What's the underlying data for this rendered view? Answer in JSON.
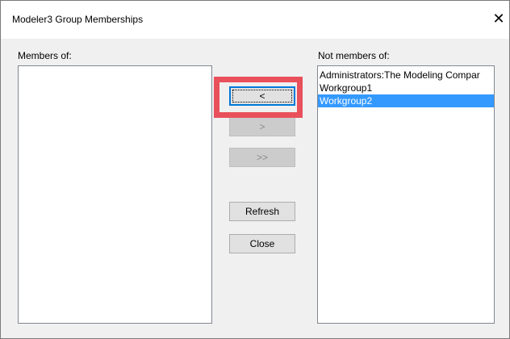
{
  "window": {
    "title": "Modeler3 Group Memberships",
    "close_glyph": "✕"
  },
  "members_label": "Members of:",
  "members_items": [],
  "not_members_label": "Not members of:",
  "not_members_items": [
    {
      "label": "Administrators:The Modeling Compar",
      "selected": false
    },
    {
      "label": "Workgroup1",
      "selected": false
    },
    {
      "label": "Workgroup2",
      "selected": true
    }
  ],
  "buttons": {
    "add_label": "<",
    "remove_label": ">",
    "remove_all_label": ">>",
    "refresh_label": "Refresh",
    "close_label": "Close"
  },
  "colors": {
    "selection": "#3399ff",
    "highlight_box": "#e8505b"
  }
}
